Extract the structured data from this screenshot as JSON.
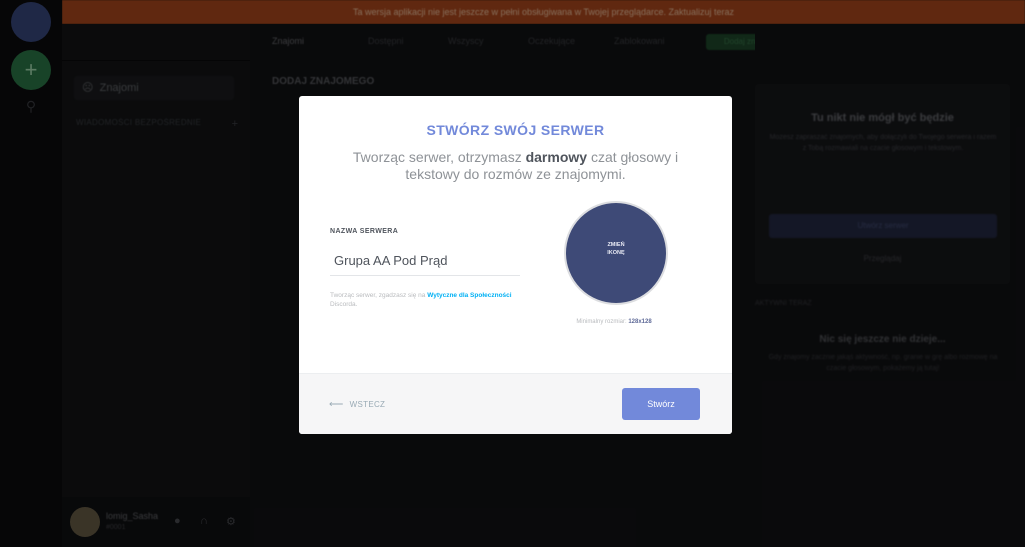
{
  "banner": {
    "text": "Ta wersja aplikacji nie jest jeszcze w pełni obsługiwana w Twojej przeglądarce. Zaktualizuj teraz"
  },
  "sidebar": {
    "friends_label": "Znajomi",
    "dm_header": "WIADOMOŚCI BEZPOŚREDNIE",
    "user": {
      "name": "lomig_Sasha",
      "tag": "#0001"
    }
  },
  "header": {
    "tabs": [
      {
        "label": "Znajomi"
      },
      {
        "label": "Dostępni"
      },
      {
        "label": "Wszyscy"
      },
      {
        "label": "Oczekujące"
      },
      {
        "label": "Zablokowani"
      }
    ],
    "add_friend_label": "Dodaj znajomego"
  },
  "main": {
    "section_title": "DODAJ ZNAJOMEGO"
  },
  "right_panel": {
    "card_title": "Tu nikt nie mógł być będzie",
    "card_text": "Możesz zapraszać znajomych, aby dołączyli do Twojego serwera i razem z Tobą rozmawiali na czacie głosowym i tekstowym.",
    "card_button": "Utwórz serwer",
    "card_link": "Przeglądaj",
    "small_label": "AKTYWNI TERAZ",
    "section_title": "Nic się jeszcze nie dzieje...",
    "section_text": "Gdy znajomy zacznie jakąś aktywność, np. granie w grę albo rozmowę na czacie głosowym, pokażemy ją tutaj!"
  },
  "modal": {
    "title": "STWÓRZ SWÓJ SERWER",
    "subtitle_before": "Tworząc serwer, otrzymasz ",
    "subtitle_bold": "darmowy",
    "subtitle_after": " czat głosowy i tekstowy do rozmów ze znajomymi.",
    "name_label": "NAZWA SERWERA",
    "name_value": "Grupa AA Pod Prąd",
    "note_before": "Tworząc serwer, zgadzasz się na ",
    "note_link": "Wytyczne dla Społeczności",
    "note_after": " Discorda.",
    "icon_line1": "ZMIEŃ",
    "icon_line2": "IKONĘ",
    "min_size_label": "Minimalny rozmiar: ",
    "min_size_value": "128x128",
    "back_label": "WSTECZ",
    "create_label": "Stwórz"
  },
  "colors": {
    "blurple": "#7289da",
    "link": "#00b0f4",
    "modal_bg": "#ffffff",
    "footer_bg": "#f6f6f7"
  }
}
